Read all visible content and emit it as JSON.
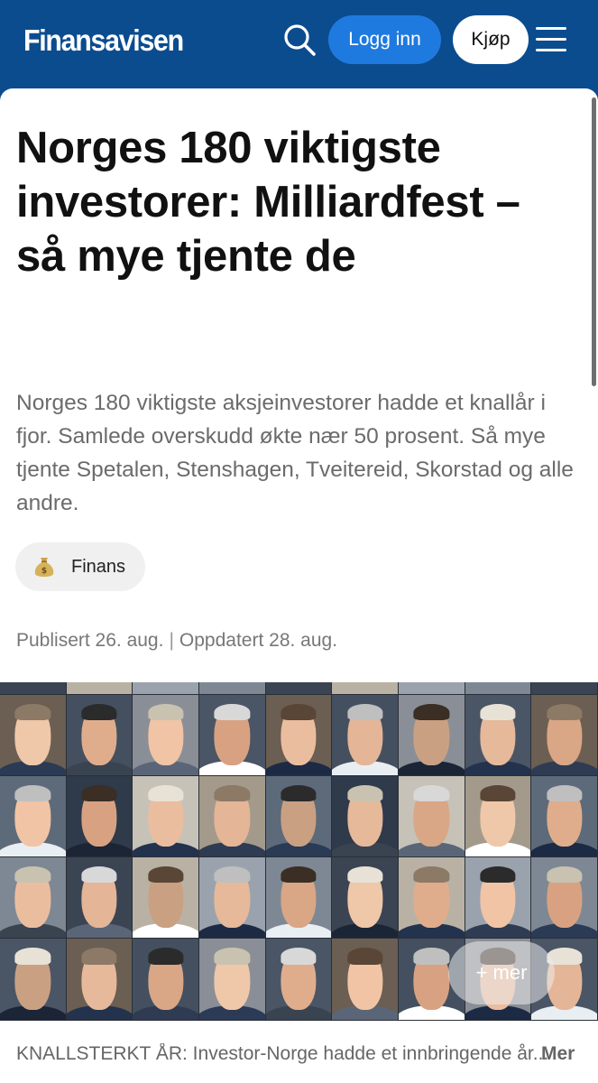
{
  "header": {
    "logo": "Finansavisen",
    "login_label": "Logg inn",
    "buy_label": "Kjøp",
    "search_icon": "search-icon",
    "menu_icon": "hamburger-menu-icon"
  },
  "article": {
    "title": "Norges 180 viktigste investorer: Milliardfest – så mye tjente de",
    "lead": "Norges 180 viktigste aksjeinvestorer hadde et knallår i fjor. Samlede overskudd økte nær 50 prosent. Så mye tjente Spetalen, Stenshagen, Tveitereid, Skorstad og alle andre.",
    "tag": {
      "label": "Finans",
      "icon": "money-bag-icon"
    },
    "published": "Publisert 26. aug.",
    "separator": "|",
    "updated": "Oppdatert 28. aug."
  },
  "image": {
    "more_label": "+ mer",
    "caption": "KNALLSTERKT ÅR: Investor-Norge hadde et innbringende år...",
    "caption_more": "Mer"
  },
  "colors": {
    "brand": "#0b4c8f",
    "login_button": "#1f7ae0",
    "tag_bg": "#f0f0f0",
    "lead_text": "#6b6b6b"
  }
}
